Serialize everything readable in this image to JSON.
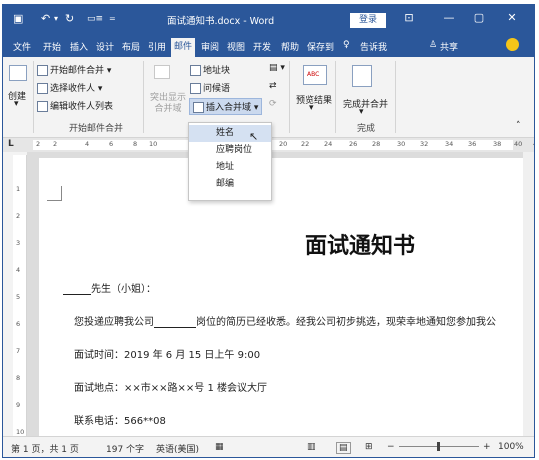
{
  "window": {
    "title": "面试通知书.docx - Word",
    "login_label": "登录",
    "quick_access": [
      "save-icon",
      "undo-icon",
      "redo-icon",
      "touch-mode-icon",
      "customize-icon"
    ],
    "controls": [
      "ribbon-display-icon",
      "minimize-icon",
      "restore-icon",
      "close-icon"
    ]
  },
  "tabs": [
    "文件",
    "开始",
    "插入",
    "设计",
    "布局",
    "引用",
    "邮件",
    "审阅",
    "视图",
    "开发",
    "帮助",
    "保存到",
    "告诉我",
    "共享"
  ],
  "tabs_active": "邮件",
  "ribbon": {
    "create_label": "创建",
    "start_merge_group": {
      "items": [
        "开始邮件合并",
        "选择收件人",
        "编辑收件人列表"
      ],
      "label": "开始邮件合并"
    },
    "write_insert_group": {
      "highlight_label": "突出显示合并域",
      "items": [
        "地址块",
        "问候语",
        "插入合并域"
      ]
    },
    "preview_label": "预览结果",
    "preview_icon_text": "ABC",
    "finish_label": "完成并合并",
    "finish_group_label": "完成"
  },
  "ruler_ticks": [
    "2",
    "2",
    "4",
    "6",
    "8",
    "10",
    "20",
    "22",
    "24",
    "26",
    "28",
    "30",
    "32",
    "34",
    "36",
    "38",
    "40",
    "42"
  ],
  "vertical_ruler_ticks": [
    "1",
    "2",
    "3",
    "4",
    "5",
    "6",
    "7",
    "8",
    "9",
    "10"
  ],
  "merge_menu": {
    "items": [
      "姓名",
      "应聘岗位",
      "地址",
      "邮编"
    ],
    "hover_index": 0
  },
  "document": {
    "title": "面试通知书",
    "salutation": "先生（小姐）：",
    "line1_pre": "您投递应聘我公司",
    "line1_post": "岗位的简历已经收悉。经我公司初步挑选，现荣幸地通知您参加我公",
    "time": "面试时间：2019 年 6 月 15 日上午 9:00",
    "place": "面试地点：××市××路××号 1 楼会议大厅",
    "phone": "联系电话：566**08"
  },
  "status": {
    "page": "第 1 页，共 1 页",
    "words": "197 个字",
    "language": "英语(美国)",
    "zoom": "100%"
  }
}
